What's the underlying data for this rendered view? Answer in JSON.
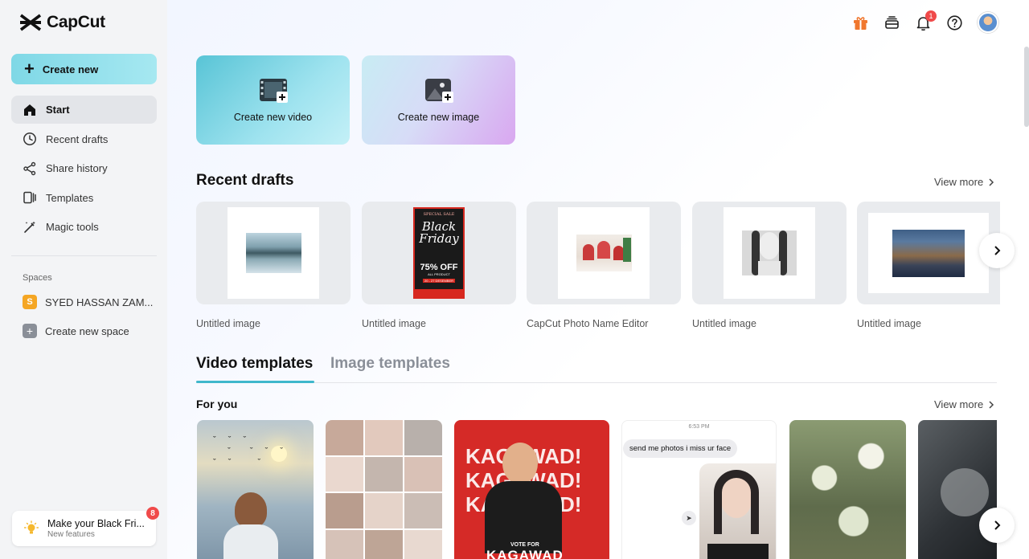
{
  "brand": {
    "name": "CapCut"
  },
  "sidebar": {
    "create_new": "Create new",
    "nav": [
      {
        "label": "Start",
        "icon": "home-icon",
        "active": true
      },
      {
        "label": "Recent drafts",
        "icon": "clock-icon"
      },
      {
        "label": "Share history",
        "icon": "share-icon"
      },
      {
        "label": "Templates",
        "icon": "templates-icon"
      },
      {
        "label": "Magic tools",
        "icon": "magic-wand-icon"
      }
    ],
    "spaces_label": "Spaces",
    "spaces": [
      {
        "label": "SYED HASSAN ZAM...",
        "initial": "S"
      },
      {
        "label": "Create new space"
      }
    ],
    "promo": {
      "title": "Make your Black Fri...",
      "subtitle": "New features",
      "badge": "8"
    }
  },
  "topbar": {
    "notification_count": "1"
  },
  "create_cards": {
    "video": "Create new video",
    "image": "Create new image"
  },
  "recent_drafts": {
    "title": "Recent drafts",
    "view_more": "View more",
    "items": [
      {
        "caption": "Untitled image"
      },
      {
        "caption": "Untitled image",
        "poster": {
          "top": "SPECIAL SALE",
          "line1": "Black",
          "line2": "Friday",
          "offer": "75% OFF",
          "sub": "ALL PRODUCT",
          "dates": "20 - 27 DESEMBER"
        }
      },
      {
        "caption": "CapCut Photo Name Editor"
      },
      {
        "caption": "Untitled image"
      },
      {
        "caption": "Untitled image"
      }
    ]
  },
  "templates": {
    "tabs": [
      "Video templates",
      "Image templates"
    ],
    "for_you": "For you",
    "view_more": "View more",
    "items": [
      {
        "kind": "photo"
      },
      {
        "kind": "collage"
      },
      {
        "kind": "poster",
        "headline": "KAGAWAD!",
        "footer": "VOTE FOR",
        "footer2": "KAGAWAD"
      },
      {
        "kind": "chat",
        "time": "6:53 PM",
        "message": "send me photos i miss ur face"
      },
      {
        "kind": "bokeh"
      },
      {
        "kind": "dark"
      }
    ]
  },
  "colors": {
    "accent": "#3fb7cc",
    "badge": "#f04a4a",
    "gift": "#f0772e"
  }
}
